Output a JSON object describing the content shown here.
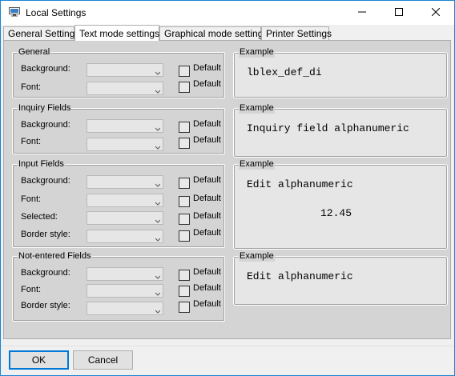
{
  "window": {
    "title": "Local Settings",
    "accent": "#1883d7"
  },
  "titlebar_buttons": {
    "minimize": "minimize-icon",
    "maximize": "maximize-icon",
    "close": "close-icon"
  },
  "tabs": [
    {
      "label": "General Settings",
      "active": false
    },
    {
      "label": "Text mode settings",
      "active": true
    },
    {
      "label": "Graphical mode settings",
      "active": false
    },
    {
      "label": "Printer Settings",
      "active": false
    }
  ],
  "groups": {
    "general": {
      "title": "General",
      "rows": [
        "Background:",
        "Font:"
      ]
    },
    "inquiry": {
      "title": "Inquiry Fields",
      "rows": [
        "Background:",
        "Font:"
      ]
    },
    "input": {
      "title": "Input Fields",
      "rows": [
        "Background:",
        "Font:",
        "Selected:",
        "Border style:"
      ]
    },
    "notentered": {
      "title": "Not-entered Fields",
      "rows": [
        "Background:",
        "Font:",
        "Border style:"
      ]
    }
  },
  "checkbox_label": "Default",
  "examples": {
    "general": {
      "title": "Example",
      "text": "lblex_def_di"
    },
    "inquiry": {
      "title": "Example",
      "text": "Inquiry field alphanumeric"
    },
    "input": {
      "title": "Example",
      "text": "Edit alphanumeric",
      "number": "12.45"
    },
    "notentered": {
      "title": "Example",
      "text": "Edit alphanumeric"
    }
  },
  "buttons": {
    "ok": "OK",
    "cancel": "Cancel"
  }
}
